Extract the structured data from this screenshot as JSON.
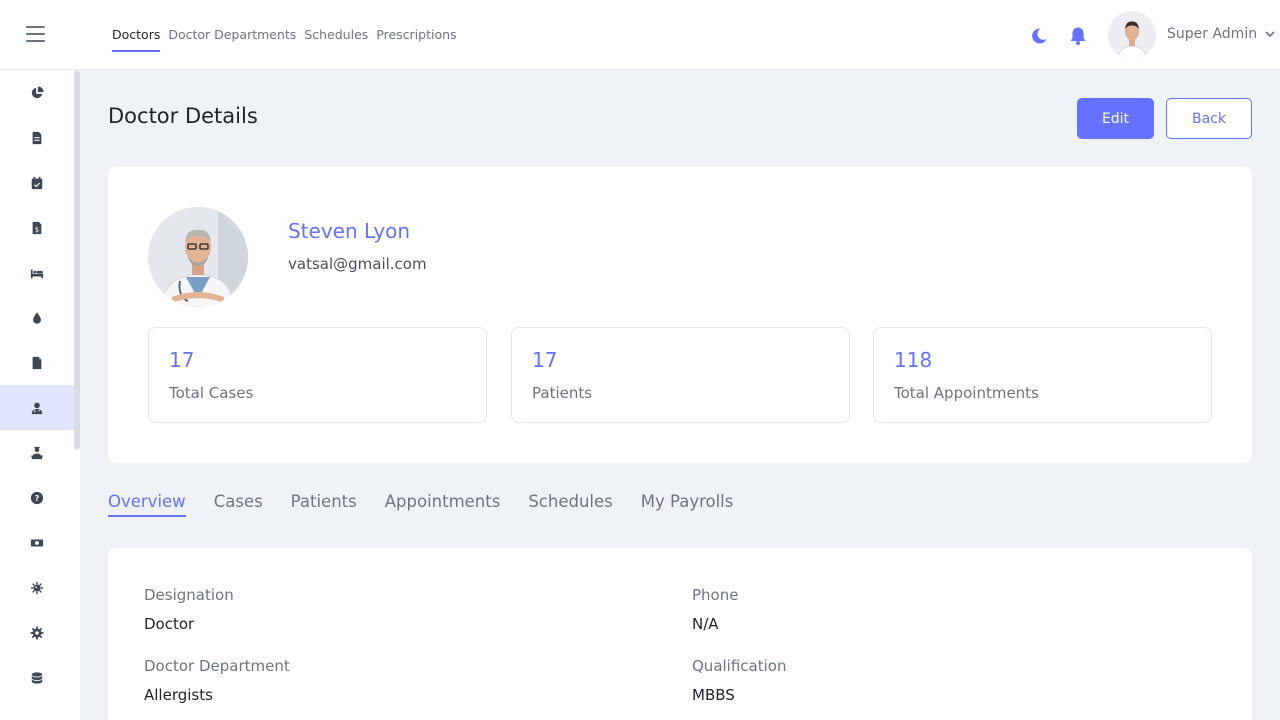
{
  "topnav": {
    "items": [
      "Doctors",
      "Doctor Departments",
      "Schedules",
      "Prescriptions"
    ]
  },
  "user": {
    "name": "Super Admin"
  },
  "colors": {
    "accent": "#6571ff",
    "background": "#eff3f7"
  },
  "sidebar": {
    "icons": [
      "chart-pie-icon",
      "file-icon",
      "calendar-check-icon",
      "file-invoice-dollar-icon",
      "bed-icon",
      "blood-drop-icon",
      "document-icon",
      "user-doctor-icon",
      "user-nurse-icon",
      "question-circle-icon",
      "money-bill-icon",
      "virus-icon",
      "gear-icon",
      "coins-icon"
    ],
    "active_index": 7
  },
  "page": {
    "title": "Doctor Details",
    "edit_label": "Edit",
    "back_label": "Back"
  },
  "profile": {
    "name": "Steven Lyon",
    "email": "vatsal@gmail.com"
  },
  "stats": [
    {
      "value": "17",
      "label": "Total Cases"
    },
    {
      "value": "17",
      "label": "Patients"
    },
    {
      "value": "118",
      "label": "Total Appointments"
    }
  ],
  "tabs": [
    "Overview",
    "Cases",
    "Patients",
    "Appointments",
    "Schedules",
    "My Payrolls"
  ],
  "details": {
    "designation_label": "Designation",
    "designation_value": "Doctor",
    "phone_label": "Phone",
    "phone_value": "N/A",
    "department_label": "Doctor Department",
    "department_value": "Allergists",
    "qualification_label": "Qualification",
    "qualification_value": "MBBS"
  }
}
